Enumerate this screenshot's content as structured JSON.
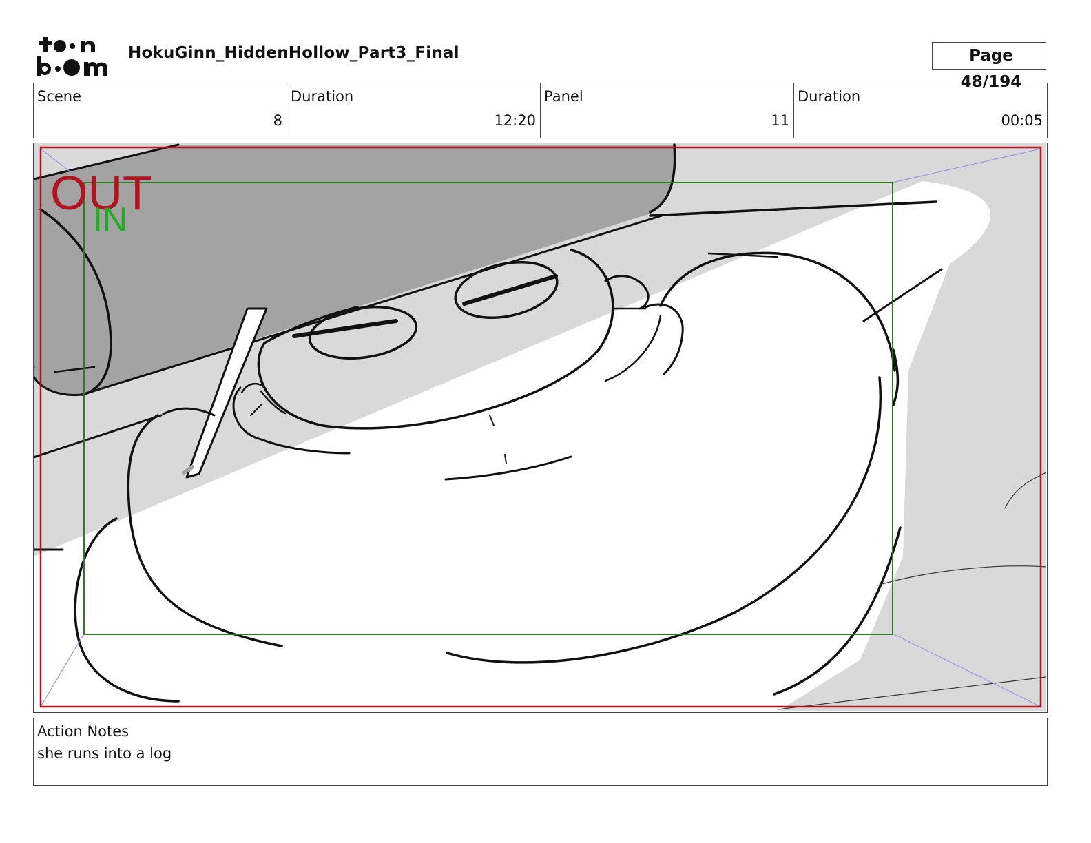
{
  "header": {
    "logo_alt": "toon boom",
    "document_title": "HokuGinn_HiddenHollow_Part3_Final",
    "page_label": "Page",
    "page_number": "48/194"
  },
  "info": [
    {
      "label": "Scene",
      "value": "8"
    },
    {
      "label": "Duration",
      "value": "12:20"
    },
    {
      "label": "Panel",
      "value": "11"
    },
    {
      "label": "Duration",
      "value": "00:05"
    }
  ],
  "panel": {
    "out_label": "OUT",
    "in_label": "IN",
    "colors": {
      "out_frame": "#b0141e",
      "in_frame": "#2e7d1f",
      "in_text": "#1fae1f",
      "guide": "#9a9ad8",
      "shade_light": "#d9d9d9",
      "shade_dark": "#a3a3a3"
    }
  },
  "notes": {
    "label": "Action Notes",
    "text": "she runs into a log"
  }
}
